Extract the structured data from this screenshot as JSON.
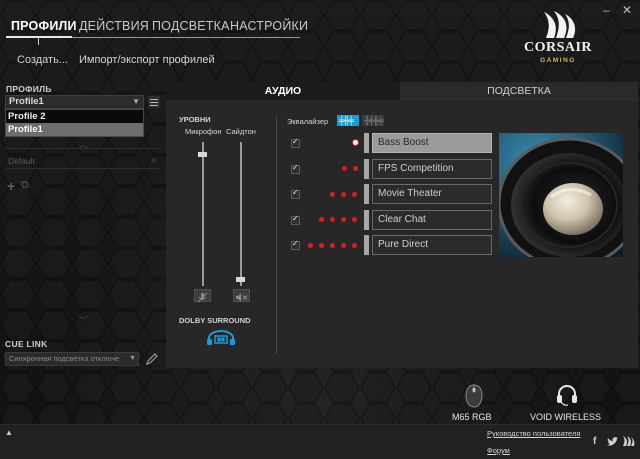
{
  "window": {
    "minimize_icon": "minimize-icon",
    "close_icon": "close-icon"
  },
  "nav": {
    "tabs": [
      {
        "label": "ПРОФИЛИ",
        "active": true
      },
      {
        "label": "ДЕЙСТВИЯ",
        "active": false
      },
      {
        "label": "ПОДСВЕТКА",
        "active": false
      },
      {
        "label": "НАСТРОЙКИ",
        "active": false
      }
    ],
    "sub_links": [
      "Создать...",
      "Импорт/экспорт профилей"
    ]
  },
  "logo": {
    "brand": "CORSAIR",
    "tagline": "GAMING"
  },
  "profile": {
    "section_label": "ПРОФИЛЬ",
    "selected": "Profile1",
    "options": [
      {
        "label": "Profile 2",
        "selected": false
      },
      {
        "label": "Profile1",
        "selected": true
      }
    ],
    "mode_row": "Default"
  },
  "cue_link": {
    "section_label": "CUE LINK",
    "selected": "Синхронная подсветка отключе"
  },
  "tabs": {
    "audio": "АУДИО",
    "lighting": "ПОДСВЕТКА",
    "active": "audio"
  },
  "levels": {
    "title": "УРОВНИ",
    "mic_label": "Микрофон",
    "sidetone_label": "Сайдтон",
    "mic_level": 0.92,
    "sidetone_level": 0.05
  },
  "dolby": {
    "label": "DOLBY SURROUND"
  },
  "equalizer": {
    "label": "Эквалайзер",
    "accent_color": "#1b9bd8",
    "dot_color": "#e01b1b",
    "presets": [
      {
        "name": "Bass Boost",
        "checked": true,
        "dots": 1,
        "active": true
      },
      {
        "name": "FPS Competition",
        "checked": true,
        "dots": 2,
        "active": false
      },
      {
        "name": "Movie Theater",
        "checked": true,
        "dots": 3,
        "active": false
      },
      {
        "name": "Clear Chat",
        "checked": true,
        "dots": 4,
        "active": false
      },
      {
        "name": "Pure Direct",
        "checked": true,
        "dots": 5,
        "active": false
      }
    ]
  },
  "devices": [
    {
      "name": "M65 RGB",
      "icon": "mouse-icon"
    },
    {
      "name": "VOID WIRELESS",
      "icon": "headset-icon"
    }
  ],
  "footer": {
    "links": [
      "Руководство пользователя",
      "Форум"
    ]
  }
}
